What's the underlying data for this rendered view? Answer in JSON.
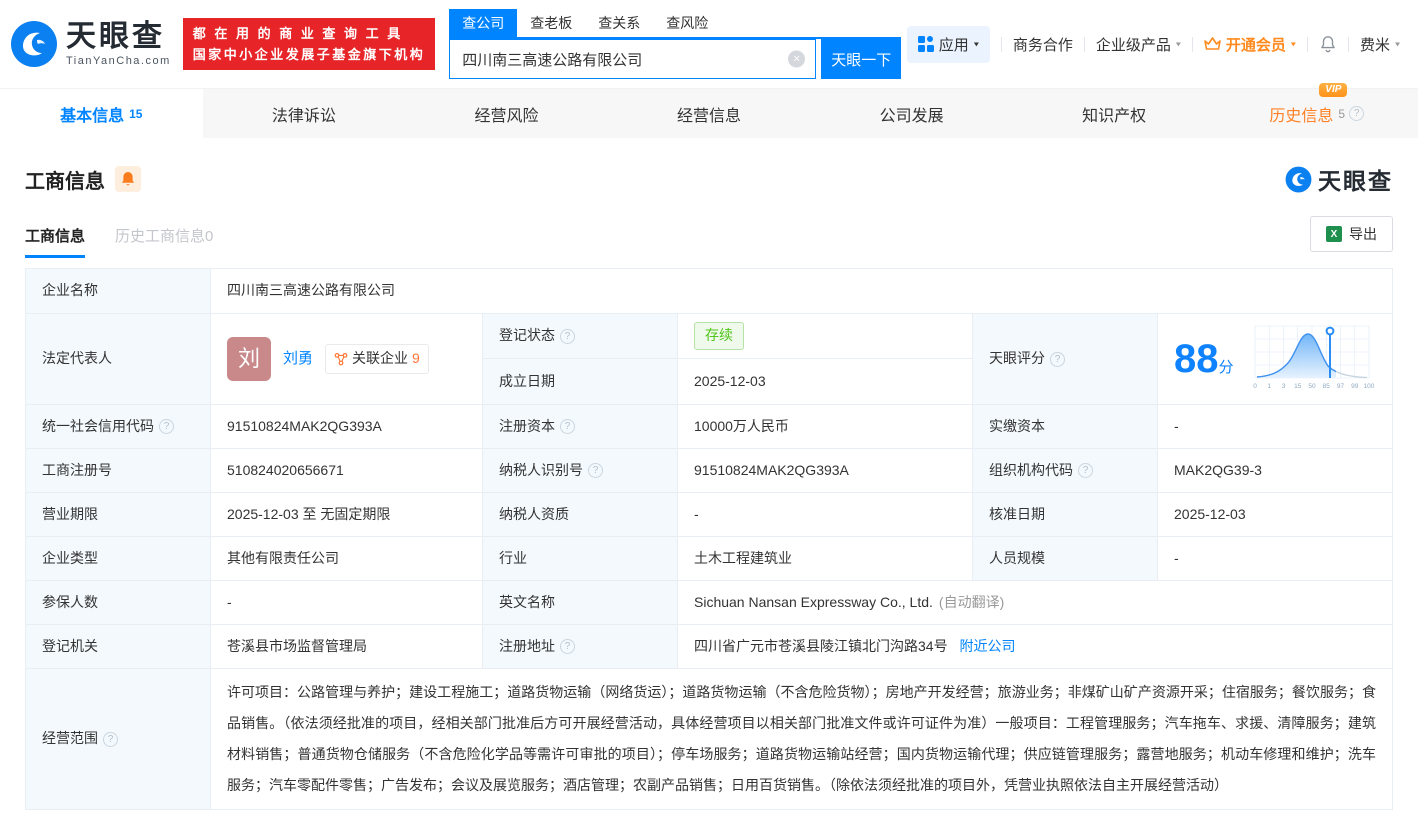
{
  "colors": {
    "brand_blue": "#0084ff",
    "promo_red": "#e72528",
    "vip_orange": "#ff8a1e",
    "history_tab_orange": "#ff8125",
    "status_green": "#52c41a",
    "score_blue": "#0f82ff",
    "label_cell_bg": "#f3f9fd"
  },
  "icons": {
    "help": "?",
    "caret": "▾",
    "clear": "×",
    "excel": "X"
  },
  "header": {
    "logo_title": "天眼查",
    "logo_subtitle": "TianYanCha.com",
    "promo_line1": "都 在 用 的 商 业 查 询 工 具",
    "promo_line2": "国家中小企业发展子基金旗下机构",
    "search": {
      "tabs": [
        {
          "label": "查公司",
          "active": true
        },
        {
          "label": "查老板",
          "active": false
        },
        {
          "label": "查关系",
          "active": false
        },
        {
          "label": "查风险",
          "active": false
        }
      ],
      "input_value": "四川南三高速公路有限公司",
      "button_label": "天眼一下"
    },
    "nav": {
      "apps": "应用",
      "cooperation": "商务合作",
      "enterprise": "企业级产品",
      "vip": "开通会员",
      "username": "费米"
    }
  },
  "tabs": [
    {
      "label": "基本信息",
      "count": "15"
    },
    {
      "label": "法律诉讼"
    },
    {
      "label": "经营风险"
    },
    {
      "label": "经营信息"
    },
    {
      "label": "公司发展"
    },
    {
      "label": "知识产权"
    },
    {
      "label": "历史信息",
      "count": "5",
      "badge": "VIP"
    }
  ],
  "section": {
    "title": "工商信息",
    "watermark": "天眼查",
    "subtabs": [
      {
        "label": "工商信息",
        "active": true
      },
      {
        "label": "历史工商信息0",
        "active": false
      }
    ],
    "export_label": "导出"
  },
  "fields": {
    "company_name": {
      "label": "企业名称",
      "value": "四川南三高速公路有限公司"
    },
    "legal_rep": {
      "label": "法定代表人",
      "avatar_char": "刘",
      "name": "刘勇",
      "related_label": "关联企业",
      "related_count": "9"
    },
    "reg_status": {
      "label": "登记状态",
      "value": "存续"
    },
    "establish_date": {
      "label": "成立日期",
      "value": "2025-12-03"
    },
    "tyc_score": {
      "label": "天眼评分",
      "score": "88",
      "unit": "分",
      "axis": [
        "0",
        "1",
        "3",
        "15",
        "50",
        "85",
        "97",
        "99",
        "100"
      ]
    },
    "credit_code": {
      "label": "统一社会信用代码",
      "value": "91510824MAK2QG393A"
    },
    "reg_capital": {
      "label": "注册资本",
      "value": "10000万人民币"
    },
    "paid_capital": {
      "label": "实缴资本",
      "value": "-"
    },
    "reg_number": {
      "label": "工商注册号",
      "value": "510824020656671"
    },
    "taxpayer_id": {
      "label": "纳税人识别号",
      "value": "91510824MAK2QG393A"
    },
    "org_code": {
      "label": "组织机构代码",
      "value": "MAK2QG39-3"
    },
    "business_term": {
      "label": "营业期限",
      "value": "2025-12-03 至 无固定期限"
    },
    "taxpayer_qualification": {
      "label": "纳税人资质",
      "value": "-"
    },
    "approval_date": {
      "label": "核准日期",
      "value": "2025-12-03"
    },
    "company_type": {
      "label": "企业类型",
      "value": "其他有限责任公司"
    },
    "industry": {
      "label": "行业",
      "value": "土木工程建筑业"
    },
    "staff_size": {
      "label": "人员规模",
      "value": "-"
    },
    "insured_count": {
      "label": "参保人数",
      "value": "-"
    },
    "english_name": {
      "label": "英文名称",
      "value": "Sichuan Nansan Expressway Co., Ltd.",
      "note": "(自动翻译)"
    },
    "reg_authority": {
      "label": "登记机关",
      "value": "苍溪县市场监督管理局"
    },
    "reg_address": {
      "label": "注册地址",
      "value": "四川省广元市苍溪县陵江镇北门沟路34号",
      "link": "附近公司"
    },
    "business_scope": {
      "label": "经营范围",
      "value": "许可项目：公路管理与养护；建设工程施工；道路货物运输（网络货运）；道路货物运输（不含危险货物）；房地产开发经营；旅游业务；非煤矿山矿产资源开采；住宿服务；餐饮服务；食品销售。（依法须经批准的项目，经相关部门批准后方可开展经营活动，具体经营项目以相关部门批准文件或许可证件为准）一般项目：工程管理服务；汽车拖车、求援、清障服务；建筑材料销售；普通货物仓储服务（不含危险化学品等需许可审批的项目）；停车场服务；道路货物运输站经营；国内货物运输代理；供应链管理服务；露营地服务；机动车修理和维护；洗车服务；汽车零配件零售；广告发布；会议及展览服务；酒店管理；农副产品销售；日用百货销售。（除依法须经批准的项目外，凭营业执照依法自主开展经营活动）"
    }
  }
}
